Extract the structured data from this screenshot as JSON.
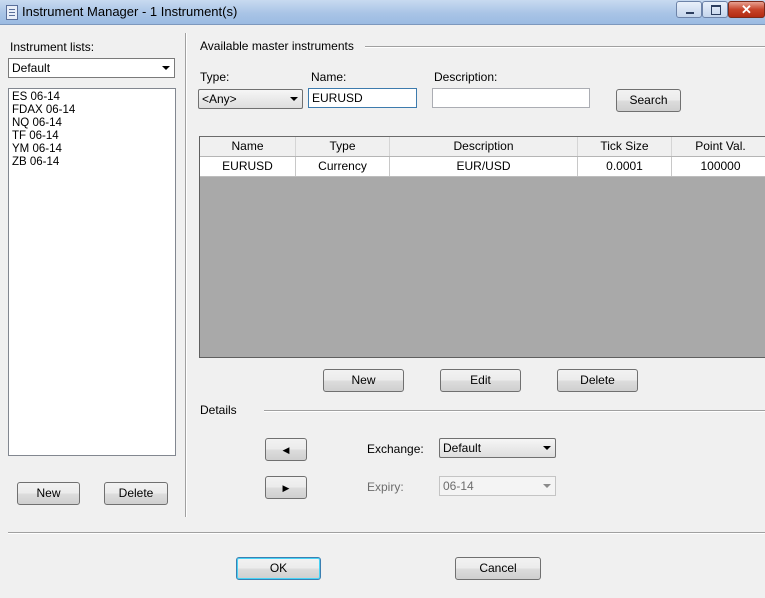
{
  "window": {
    "title": "Instrument Manager - 1 Instrument(s)"
  },
  "left": {
    "lists_label": "Instrument lists:",
    "selected_list": "Default",
    "instruments": [
      "ES 06-14",
      "FDAX 06-14",
      "NQ 06-14",
      "TF 06-14",
      "YM 06-14",
      "ZB 06-14"
    ],
    "new_label": "New",
    "delete_label": "Delete"
  },
  "master": {
    "group_label": "Available master instruments",
    "type_label": "Type:",
    "type_value": "<Any>",
    "name_label": "Name:",
    "name_value": "EURUSD",
    "description_label": "Description:",
    "description_value": "",
    "search_label": "Search",
    "columns": [
      "Name",
      "Type",
      "Description",
      "Tick Size",
      "Point Val."
    ],
    "rows": [
      [
        "EURUSD",
        "Currency",
        "EUR/USD",
        "0.0001",
        "100000"
      ]
    ],
    "new_label": "New",
    "edit_label": "Edit",
    "delete_label": "Delete"
  },
  "details": {
    "group_label": "Details",
    "exchange_label": "Exchange:",
    "exchange_value": "Default",
    "expiry_label": "Expiry:",
    "expiry_value": "06-14",
    "left_arrow": "◀",
    "right_arrow": "▶"
  },
  "footer": {
    "ok_label": "OK",
    "cancel_label": "Cancel"
  }
}
